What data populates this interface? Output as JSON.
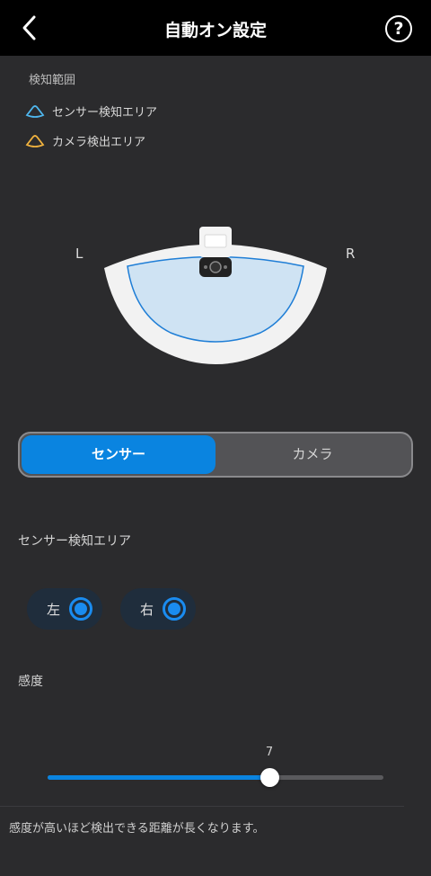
{
  "header": {
    "title": "自動オン設定",
    "help_label": "?"
  },
  "detection": {
    "heading": "検知範囲",
    "legend": [
      {
        "label": "センサー検知エリア",
        "color": "#4fb7ee",
        "icon": "sensor-area-icon"
      },
      {
        "label": "カメラ検出エリア",
        "color": "#f0b23e",
        "icon": "camera-area-icon"
      }
    ],
    "left_label": "L",
    "right_label": "R"
  },
  "mode_tabs": [
    {
      "label": "センサー",
      "active": true
    },
    {
      "label": "カメラ",
      "active": false
    }
  ],
  "sensor_section": {
    "label": "センサー検知エリア",
    "sides": [
      {
        "label": "左",
        "selected": true
      },
      {
        "label": "右",
        "selected": true
      }
    ]
  },
  "sensitivity": {
    "label": "感度",
    "value": "7",
    "fill_fraction": 0.66
  },
  "note": "感度が高いほど検出できる距離が長くなります。",
  "colors": {
    "accent": "#0a84e0",
    "background": "#2b2b2d",
    "header": "#000000"
  }
}
